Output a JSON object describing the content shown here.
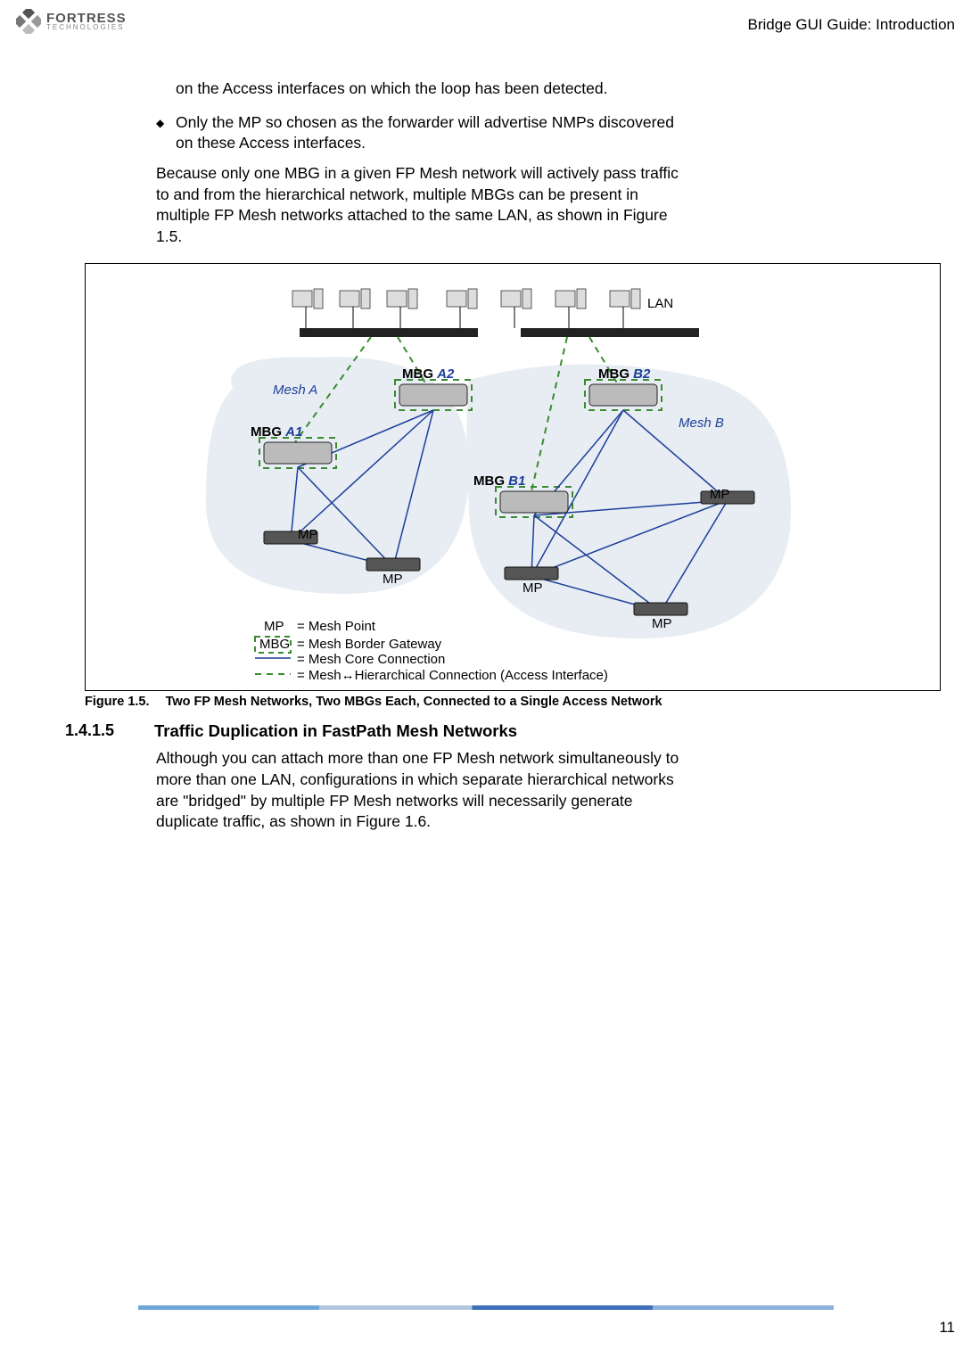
{
  "header": {
    "logo_line1": "FORTRESS",
    "logo_line2": "TECHNOLOGIES",
    "right": "Bridge GUI Guide: Introduction"
  },
  "body": {
    "para1_a": "on the Access interfaces on which the loop has been detected.",
    "bullet1": "Only the MP so chosen as the forwarder will advertise NMPs discovered on these Access interfaces.",
    "para2": "Because only one MBG in a given FP Mesh network will actively pass traffic to and from the hierarchical network, multiple MBGs can be present in multiple FP Mesh networks attached to the same LAN, as shown in Figure 1.5."
  },
  "figure": {
    "caption_num": "Figure 1.5.",
    "caption_text": "Two FP Mesh Networks, Two MBGs Each, Connected to a Single Access Network",
    "labels": {
      "lan": "LAN",
      "mesh_a": "Mesh A",
      "mesh_b": "Mesh B",
      "mbg_a1": "MBG A1",
      "mbg_a2": "MBG A2",
      "mbg_b1": "MBG B1",
      "mbg_b2": "MBG B2",
      "mp": "MP"
    },
    "legend": {
      "mp_label": "MP",
      "mp_text": "= Mesh Point",
      "mbg_label": "MBG",
      "mbg_text": "= Mesh Border Gateway",
      "core_text": "= Mesh Core Connection",
      "hier_text": "= Mesh↔Hierarchical Connection (Access Interface)"
    }
  },
  "section": {
    "num": "1.4.1.5",
    "title": "Traffic Duplication in FastPath Mesh Networks",
    "para": "Although you can attach more than one FP Mesh network simultaneously to more than one LAN, configurations in which separate hierarchical networks are \"bridged\" by multiple FP Mesh networks will necessarily generate duplicate traffic, as shown in Figure 1.6."
  },
  "page_number": "11"
}
